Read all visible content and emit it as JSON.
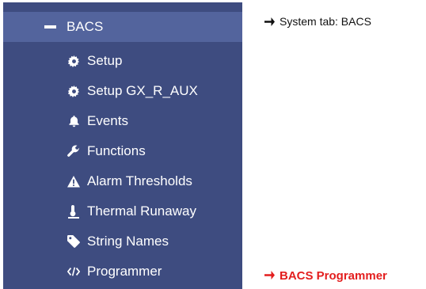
{
  "sidebar": {
    "group": {
      "label": "BACS",
      "icon": "minus-icon"
    },
    "items": [
      {
        "label": "Setup",
        "icon": "gear-icon"
      },
      {
        "label": "Setup GX_R_AUX",
        "icon": "gear-icon"
      },
      {
        "label": "Events",
        "icon": "bell-icon"
      },
      {
        "label": "Functions",
        "icon": "wrench-icon"
      },
      {
        "label": "Alarm Thresholds",
        "icon": "warning-icon"
      },
      {
        "label": "Thermal Runaway",
        "icon": "thermometer-icon"
      },
      {
        "label": "String Names",
        "icon": "tag-icon"
      },
      {
        "label": "Programmer",
        "icon": "code-icon"
      }
    ]
  },
  "annotations": {
    "system_tab": {
      "text": "System tab: BACS",
      "color": "#111111"
    },
    "programmer": {
      "text": "BACS Programmer",
      "color": "#e31e1e"
    }
  },
  "colors": {
    "sidebar_bg": "#3e4c80",
    "active_group_bg": "#53649d",
    "text": "#ffffff"
  }
}
